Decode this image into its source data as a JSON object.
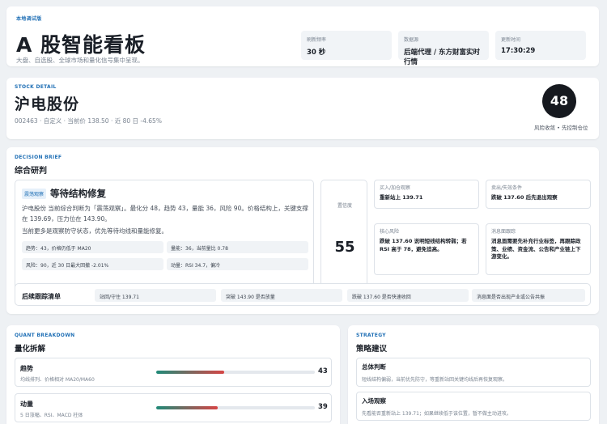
{
  "header": {
    "badge": "本地调试版",
    "title": "A 股智能看板",
    "subtitle": "大盘、自选股、全球市场和量化信号集中呈现。",
    "stats": [
      {
        "label": "刷新频率",
        "value": "30 秒"
      },
      {
        "label": "数据源",
        "value": "后端代理 / 东方财富实时行情"
      },
      {
        "label": "更新时间",
        "value": "17:30:29"
      }
    ]
  },
  "stock": {
    "eyebrow": "STOCK DETAIL",
    "name": "沪电股份",
    "meta": "002463 · 自定义 · 当前价 138.50 · 近 80 日 -4.65%",
    "score": "48",
    "score_label": "风险收敛 • 先控制仓位"
  },
  "decision": {
    "eyebrow": "DECISION BRIEF",
    "title": "综合研判",
    "tag": "震荡观察",
    "headline": "等待结构修复",
    "desc": "沪电股份 当前综合判断为「震荡观察」。最化分 48，趋势 43，量能 36，风险 90。价格结构上，关键支撑在 139.69，压力位在 143.90。",
    "desc2": "当前更多是观察防守状态，优先等待均线和量能修复。",
    "chips": [
      "趋势：43，价格仍低于 MA20",
      "量能：36，当前量比 0.78",
      "风险：90，近 30 日最大回撤 -2.01%",
      "动量：RSI 34.7，偏冷"
    ],
    "confidence_label": "置信度",
    "confidence": "55",
    "cards": [
      {
        "label": "买入/加仓观察",
        "value": "重新站上 139.71"
      },
      {
        "label": "卖出/失效条件",
        "value": "跌破 137.60 后先退出观察"
      },
      {
        "label": "核心风险",
        "value": "跌破 137.60 说明短线结构转弱；若 RSI 高于 78，避免追高。"
      },
      {
        "label": "消息面跟踪",
        "value": "消息面需要先补充行业标签，再跟踪政策、业绩、资金流、公告和产业链上下游变化。"
      }
    ],
    "follow_label": "后续跟踪清单",
    "follow": [
      "站回/守住 139.71",
      "突破 143.90 是否放量",
      "跌破 137.60 是否快速收回",
      "消息面是否出现产业或公告共振"
    ]
  },
  "quant": {
    "eyebrow": "QUANT BREAKDOWN",
    "title": "量化拆解",
    "rows": [
      {
        "label": "趋势",
        "desc": "均线排列、价格相对 MA20/MA60",
        "value": "43",
        "pct": 43
      },
      {
        "label": "动量",
        "desc": "5 日涨幅、RSI、MACD 柱体",
        "value": "39",
        "pct": 39
      }
    ]
  },
  "strategy": {
    "eyebrow": "STRATEGY",
    "title": "策略建议",
    "rows": [
      {
        "label": "总体判断",
        "desc": "短线结构偏弱，当前优先防守，等重新站回关键均线后再恢复观察。"
      },
      {
        "label": "入场观察",
        "desc": "先看能否重新站上 139.71；如果继续低于该位置，暂不做主动进攻。"
      }
    ]
  },
  "colors": {
    "accent": "#1f6fb5",
    "bar_start": "#1f8a78",
    "bar_end": "#d64545"
  }
}
